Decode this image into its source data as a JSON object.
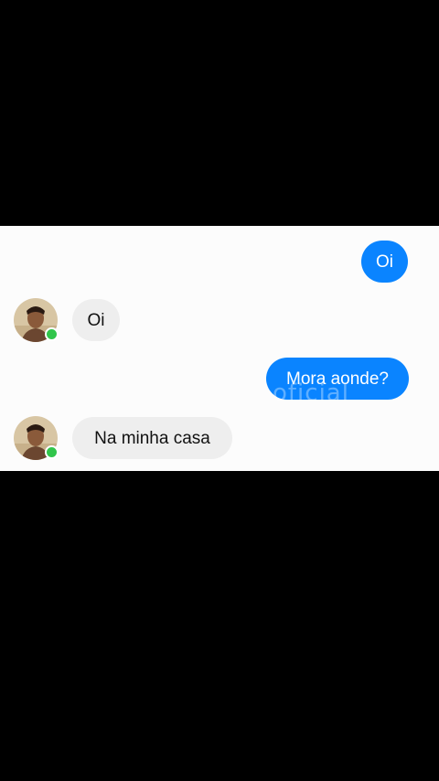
{
  "chat": {
    "messages": [
      {
        "direction": "outgoing",
        "text": "Oi"
      },
      {
        "direction": "incoming",
        "text": "Oi"
      },
      {
        "direction": "outgoing",
        "text": "Mora aonde?"
      },
      {
        "direction": "incoming",
        "text": "Na minha casa"
      }
    ],
    "watermark": "oficial",
    "colors": {
      "outgoing_bubble": "#0a84ff",
      "incoming_bubble": "#eeeeee",
      "online_indicator": "#31c54b",
      "letterbox": "#000000"
    },
    "icons": {
      "avatar": "contact-avatar-photo",
      "status": "online-status-dot"
    }
  }
}
